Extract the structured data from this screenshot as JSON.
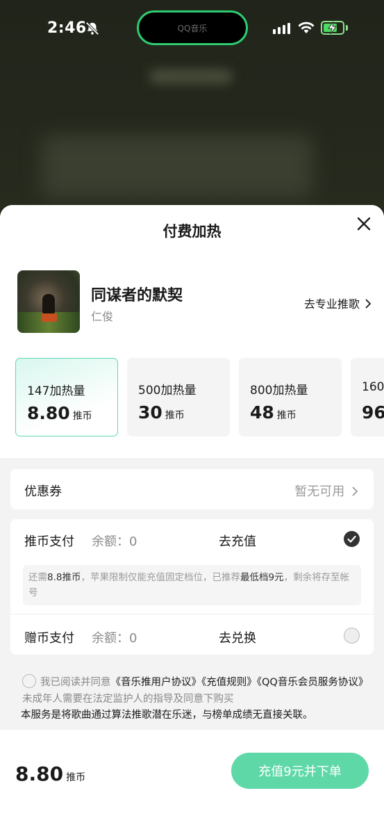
{
  "status_bar": {
    "time": "2:46",
    "island_label": "QQ音乐"
  },
  "sheet": {
    "title": "付费加热"
  },
  "song": {
    "name": "同谋者的默契",
    "artist": "仁俊",
    "pro_link": "去专业推歌"
  },
  "tiers": [
    {
      "amount": "147加热量",
      "price": "8.80",
      "unit": "推币",
      "selected": true
    },
    {
      "amount": "500加热量",
      "price": "30",
      "unit": "推币",
      "selected": false
    },
    {
      "amount": "800加热量",
      "price": "48",
      "unit": "推币",
      "selected": false
    },
    {
      "amount": "160",
      "price": "96",
      "unit": "",
      "selected": false
    }
  ],
  "coupon": {
    "label": "优惠券",
    "value": "暂无可用"
  },
  "payment": {
    "coin": {
      "label": "推币支付",
      "balance": "余额：0",
      "action": "去充值",
      "checked": true
    },
    "note": {
      "p1": "还需",
      "b1": "8.8推币",
      "p2": "，苹果限制仅能充值固定档位，已推荐",
      "b2": "最低档9元",
      "p3": "，剩余将存至帐号"
    },
    "gift": {
      "label": "赠币支付",
      "balance": "余额：0",
      "action": "去兑换",
      "checked": false
    }
  },
  "agreement": {
    "prefix": "我已阅读并同意",
    "link1": "《音乐推用户协议》",
    "link2": "《充值规则》",
    "link3": "《QQ音乐会员服务协议》",
    "suffix": "未成年人需要在法定监护人的指导及同意下购买",
    "notice": "本服务是将歌曲通过算法推歌潜在乐迷，与榜单成绩无直接关联。"
  },
  "footer": {
    "total": "8.80",
    "total_unit": "推币",
    "cta": "充值9元并下单"
  },
  "colors": {
    "accent": "#5fd8a8",
    "selected_border": "#5fd7b5"
  }
}
